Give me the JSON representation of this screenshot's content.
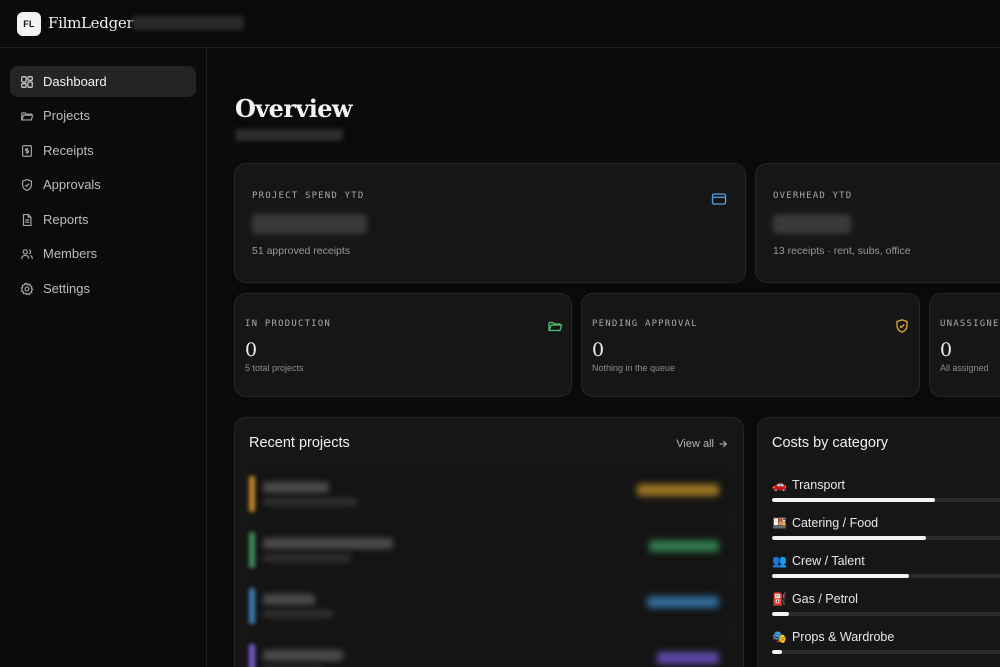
{
  "app": {
    "logo_initials": "FL",
    "brand": "FilmLedger"
  },
  "sidebar": {
    "items": [
      {
        "label": "Dashboard",
        "icon": "dashboard-icon",
        "active": true
      },
      {
        "label": "Projects",
        "icon": "folder-icon",
        "active": false
      },
      {
        "label": "Receipts",
        "icon": "receipt-icon",
        "active": false
      },
      {
        "label": "Approvals",
        "icon": "shield-check-icon",
        "active": false
      },
      {
        "label": "Reports",
        "icon": "document-icon",
        "active": false
      },
      {
        "label": "Members",
        "icon": "users-icon",
        "active": false
      },
      {
        "label": "Settings",
        "icon": "gear-icon",
        "active": false
      }
    ]
  },
  "overview": {
    "title": "Overview",
    "spend_cards": [
      {
        "kicker": "PROJECT SPEND YTD",
        "sub": "51 approved receipts",
        "icon": "credit-card-icon",
        "icon_color": "#4fa3e8"
      },
      {
        "kicker": "OVERHEAD YTD",
        "sub": "13 receipts · rent, subs, office"
      }
    ],
    "stat_cards": [
      {
        "kicker": "IN PRODUCTION",
        "value": "0",
        "sub": "5 total projects",
        "icon": "folder-icon",
        "icon_color": "#4cc46c"
      },
      {
        "kicker": "PENDING APPROVAL",
        "value": "0",
        "sub": "Nothing in the queue",
        "icon": "shield-check-icon",
        "icon_color": "#e6b12e"
      },
      {
        "kicker": "UNASSIGNED",
        "value": "0",
        "sub": "All assigned"
      }
    ]
  },
  "recent_projects": {
    "title": "Recent projects",
    "view_all": "View all",
    "accent_colors": [
      "#c98a2b",
      "#3f8f5a",
      "#3d7fb8",
      "#7a5fd0"
    ],
    "amount_colors": [
      "#9b7424",
      "#2f7a4b",
      "#2f6a98",
      "#5d49a8"
    ]
  },
  "costs": {
    "title": "Costs by category",
    "items": [
      {
        "emoji": "🚗",
        "label": "Transport",
        "fraction": 0.68
      },
      {
        "emoji": "🍱",
        "label": "Catering / Food",
        "fraction": 0.64
      },
      {
        "emoji": "👥",
        "label": "Crew / Talent",
        "fraction": 0.57
      },
      {
        "emoji": "⛽",
        "label": "Gas / Petrol",
        "fraction": 0.07
      },
      {
        "emoji": "🎭",
        "label": "Props & Wardrobe",
        "fraction": 0.04
      }
    ]
  }
}
